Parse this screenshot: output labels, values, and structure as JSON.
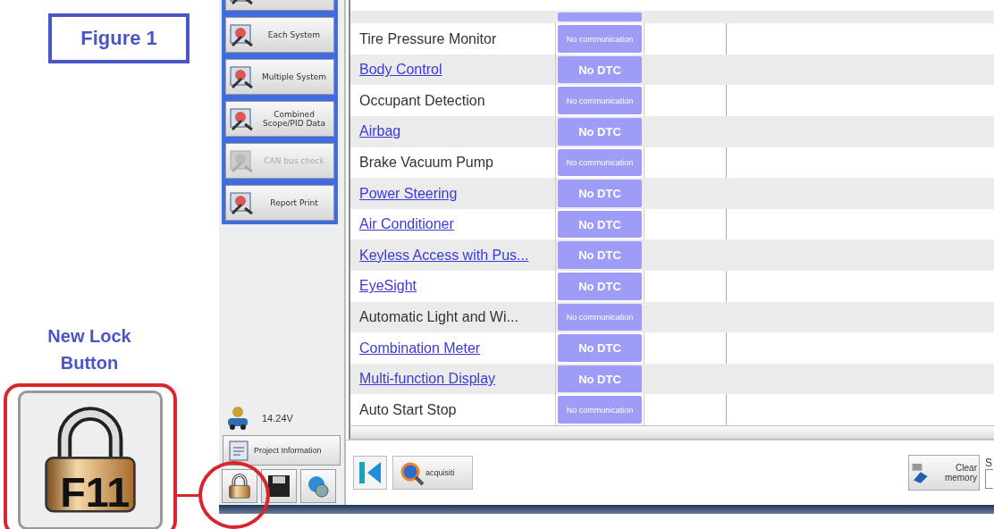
{
  "figure_label": "Figure 1",
  "callout": {
    "label": "New Lock Button",
    "key": "F11"
  },
  "side_panel": {
    "buttons": [
      {
        "disabled": false
      },
      {
        "label": "Each System",
        "disabled": false
      },
      {
        "label": "Multiple System",
        "disabled": false
      },
      {
        "label": "Combined Scope/PID Data",
        "disabled": false
      },
      {
        "label": "CAN bus check",
        "disabled": true
      },
      {
        "label": "Report Print",
        "disabled": false
      }
    ],
    "voltage": "14.24V",
    "project_button": "Project Information"
  },
  "table": {
    "rows": [
      {
        "name": "Tire Pressure Monitor",
        "kind": "plain",
        "status": {
          "text": "No communication",
          "kind": "no_comm"
        }
      },
      {
        "name": "Body Control",
        "kind": "link",
        "status": {
          "text": "No DTC",
          "kind": "ok"
        }
      },
      {
        "name": "Occupant Detection",
        "kind": "plain",
        "status": {
          "text": "No communication",
          "kind": "no_comm"
        }
      },
      {
        "name": "Airbag",
        "kind": "link",
        "status": {
          "text": "No DTC",
          "kind": "ok"
        }
      },
      {
        "name": "Brake Vacuum Pump",
        "kind": "plain",
        "status": {
          "text": "No communication",
          "kind": "no_comm"
        }
      },
      {
        "name": "Power Steering",
        "kind": "link",
        "status": {
          "text": "No DTC",
          "kind": "ok"
        }
      },
      {
        "name": "Air Conditioner",
        "kind": "link",
        "status": {
          "text": "No DTC",
          "kind": "ok"
        }
      },
      {
        "name": "Keyless Access with Pus...",
        "kind": "link",
        "status": {
          "text": "No DTC",
          "kind": "ok"
        }
      },
      {
        "name": "EyeSight",
        "kind": "link",
        "status": {
          "text": "No DTC",
          "kind": "ok"
        }
      },
      {
        "name": "Automatic Light and Wi...",
        "kind": "plain",
        "status": {
          "text": "No communication",
          "kind": "no_comm"
        }
      },
      {
        "name": "Combination Meter",
        "kind": "link",
        "status": {
          "text": "No DTC",
          "kind": "ok"
        }
      },
      {
        "name": "Multi-function Display",
        "kind": "link",
        "status": {
          "text": "No DTC",
          "kind": "ok"
        }
      },
      {
        "name": "Auto Start Stop",
        "kind": "plain",
        "status": {
          "text": "No communication",
          "kind": "no_comm"
        }
      }
    ]
  },
  "toolbar": {
    "acquisition": "acquisiti",
    "clear": "Clear memory",
    "cut_label": "S"
  }
}
